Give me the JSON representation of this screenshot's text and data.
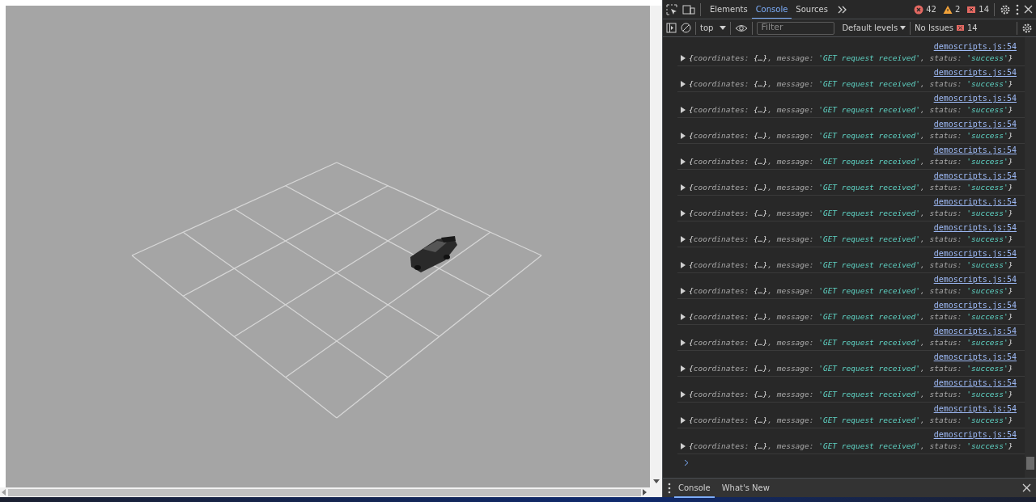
{
  "devtools": {
    "tabs": [
      {
        "label": "Elements",
        "selected": false
      },
      {
        "label": "Console",
        "selected": true
      },
      {
        "label": "Sources",
        "selected": false
      }
    ],
    "counts": [
      {
        "kind": "error",
        "value": "42"
      },
      {
        "kind": "warning",
        "value": "2"
      },
      {
        "kind": "issue",
        "value": "14"
      }
    ],
    "console_toolbar": {
      "context": "top",
      "filter": {
        "placeholder": "Filter"
      },
      "levels": "Default levels",
      "issues_label": "No Issues",
      "issues_count": "14"
    },
    "entries": [
      {
        "source": "demoscripts.js:54",
        "expanded": false,
        "open": "{",
        "close": "}",
        "fields": [
          {
            "key": "coordinates:",
            "value": "{…}",
            "kind": "object",
            "sep": ","
          },
          {
            "key": "message:",
            "value": "'GET request received'",
            "kind": "string",
            "sep": ","
          },
          {
            "key": "status:",
            "value": "'success'",
            "kind": "string"
          }
        ]
      },
      {
        "source": "demoscripts.js:54",
        "expanded": false,
        "open": "{",
        "close": "}",
        "fields": [
          {
            "key": "coordinates:",
            "value": "{…}",
            "kind": "object",
            "sep": ","
          },
          {
            "key": "message:",
            "value": "'GET request received'",
            "kind": "string",
            "sep": ","
          },
          {
            "key": "status:",
            "value": "'success'",
            "kind": "string"
          }
        ]
      },
      {
        "source": "demoscripts.js:54",
        "expanded": false,
        "open": "{",
        "close": "}",
        "fields": [
          {
            "key": "coordinates:",
            "value": "{…}",
            "kind": "object",
            "sep": ","
          },
          {
            "key": "message:",
            "value": "'GET request received'",
            "kind": "string",
            "sep": ","
          },
          {
            "key": "status:",
            "value": "'success'",
            "kind": "string"
          }
        ]
      },
      {
        "source": "demoscripts.js:54",
        "expanded": false,
        "open": "{",
        "close": "}",
        "fields": [
          {
            "key": "coordinates:",
            "value": "{…}",
            "kind": "object",
            "sep": ","
          },
          {
            "key": "message:",
            "value": "'GET request received'",
            "kind": "string",
            "sep": ","
          },
          {
            "key": "status:",
            "value": "'success'",
            "kind": "string"
          }
        ]
      },
      {
        "source": "demoscripts.js:54",
        "expanded": false,
        "open": "{",
        "close": "}",
        "fields": [
          {
            "key": "coordinates:",
            "value": "{…}",
            "kind": "object",
            "sep": ","
          },
          {
            "key": "message:",
            "value": "'GET request received'",
            "kind": "string",
            "sep": ","
          },
          {
            "key": "status:",
            "value": "'success'",
            "kind": "string"
          }
        ]
      },
      {
        "source": "demoscripts.js:54",
        "expanded": false,
        "open": "{",
        "close": "}",
        "fields": [
          {
            "key": "coordinates:",
            "value": "{…}",
            "kind": "object",
            "sep": ","
          },
          {
            "key": "message:",
            "value": "'GET request received'",
            "kind": "string",
            "sep": ","
          },
          {
            "key": "status:",
            "value": "'success'",
            "kind": "string"
          }
        ]
      },
      {
        "source": "demoscripts.js:54",
        "expanded": false,
        "open": "{",
        "close": "}",
        "fields": [
          {
            "key": "coordinates:",
            "value": "{…}",
            "kind": "object",
            "sep": ","
          },
          {
            "key": "message:",
            "value": "'GET request received'",
            "kind": "string",
            "sep": ","
          },
          {
            "key": "status:",
            "value": "'success'",
            "kind": "string"
          }
        ]
      },
      {
        "source": "demoscripts.js:54",
        "expanded": false,
        "open": "{",
        "close": "}",
        "fields": [
          {
            "key": "coordinates:",
            "value": "{…}",
            "kind": "object",
            "sep": ","
          },
          {
            "key": "message:",
            "value": "'GET request received'",
            "kind": "string",
            "sep": ","
          },
          {
            "key": "status:",
            "value": "'success'",
            "kind": "string"
          }
        ]
      },
      {
        "source": "demoscripts.js:54",
        "expanded": false,
        "open": "{",
        "close": "}",
        "fields": [
          {
            "key": "coordinates:",
            "value": "{…}",
            "kind": "object",
            "sep": ","
          },
          {
            "key": "message:",
            "value": "'GET request received'",
            "kind": "string",
            "sep": ","
          },
          {
            "key": "status:",
            "value": "'success'",
            "kind": "string"
          }
        ]
      },
      {
        "source": "demoscripts.js:54",
        "expanded": false,
        "open": "{",
        "close": "}",
        "fields": [
          {
            "key": "coordinates:",
            "value": "{…}",
            "kind": "object",
            "sep": ","
          },
          {
            "key": "message:",
            "value": "'GET request received'",
            "kind": "string",
            "sep": ","
          },
          {
            "key": "status:",
            "value": "'success'",
            "kind": "string"
          }
        ]
      },
      {
        "source": "demoscripts.js:54",
        "expanded": false,
        "open": "{",
        "close": "}",
        "fields": [
          {
            "key": "coordinates:",
            "value": "{…}",
            "kind": "object",
            "sep": ","
          },
          {
            "key": "message:",
            "value": "'GET request received'",
            "kind": "string",
            "sep": ","
          },
          {
            "key": "status:",
            "value": "'success'",
            "kind": "string"
          }
        ]
      },
      {
        "source": "demoscripts.js:54",
        "expanded": false,
        "open": "{",
        "close": "}",
        "fields": [
          {
            "key": "coordinates:",
            "value": "{…}",
            "kind": "object",
            "sep": ","
          },
          {
            "key": "message:",
            "value": "'GET request received'",
            "kind": "string",
            "sep": ","
          },
          {
            "key": "status:",
            "value": "'success'",
            "kind": "string"
          }
        ]
      },
      {
        "source": "demoscripts.js:54",
        "expanded": false,
        "open": "{",
        "close": "}",
        "fields": [
          {
            "key": "coordinates:",
            "value": "{…}",
            "kind": "object",
            "sep": ","
          },
          {
            "key": "message:",
            "value": "'GET request received'",
            "kind": "string",
            "sep": ","
          },
          {
            "key": "status:",
            "value": "'success'",
            "kind": "string"
          }
        ]
      },
      {
        "source": "demoscripts.js:54",
        "expanded": false,
        "open": "{",
        "close": "}",
        "fields": [
          {
            "key": "coordinates:",
            "value": "{…}",
            "kind": "object",
            "sep": ","
          },
          {
            "key": "message:",
            "value": "'GET request received'",
            "kind": "string",
            "sep": ","
          },
          {
            "key": "status:",
            "value": "'success'",
            "kind": "string"
          }
        ]
      },
      {
        "source": "demoscripts.js:54",
        "expanded": false,
        "open": "{",
        "close": "}",
        "fields": [
          {
            "key": "coordinates:",
            "value": "{…}",
            "kind": "object",
            "sep": ","
          },
          {
            "key": "message:",
            "value": "'GET request received'",
            "kind": "string",
            "sep": ","
          },
          {
            "key": "status:",
            "value": "'success'",
            "kind": "string"
          }
        ]
      },
      {
        "source": "demoscripts.js:54",
        "expanded": false,
        "open": "{",
        "close": "}",
        "fields": [
          {
            "key": "coordinates:",
            "value": "{…}",
            "kind": "object",
            "sep": ","
          },
          {
            "key": "message:",
            "value": "'GET request received'",
            "kind": "string",
            "sep": ","
          },
          {
            "key": "status:",
            "value": "'success'",
            "kind": "string"
          }
        ]
      }
    ],
    "drawer_tabs": [
      {
        "label": "Console",
        "selected": true
      },
      {
        "label": "What's New",
        "selected": false
      }
    ]
  }
}
